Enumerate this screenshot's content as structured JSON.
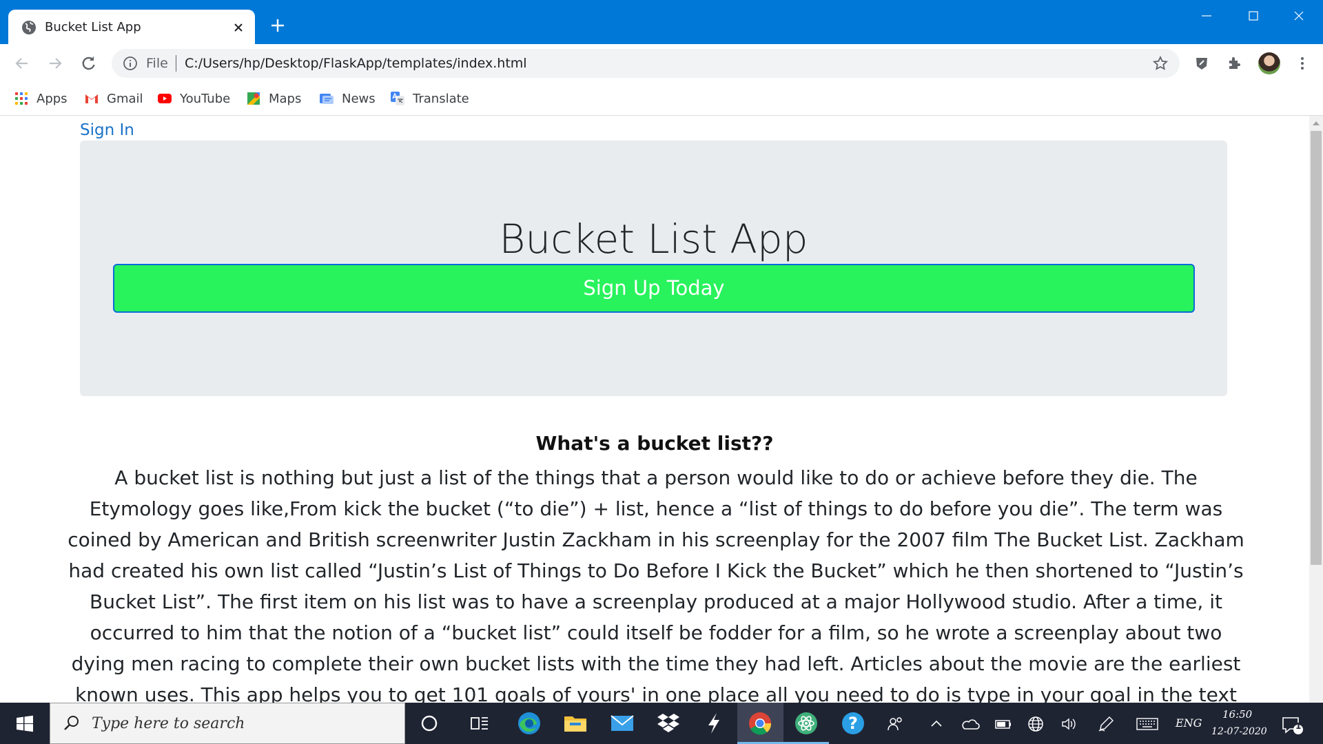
{
  "browser": {
    "tab_title": "Bucket List App",
    "address_scheme": "File",
    "address_url": "C:/Users/hp/Desktop/FlaskApp/templates/index.html"
  },
  "bookmarks": [
    {
      "label": "Apps",
      "icon": "apps-grid-icon"
    },
    {
      "label": "Gmail",
      "icon": "gmail-icon"
    },
    {
      "label": "YouTube",
      "icon": "youtube-icon"
    },
    {
      "label": "Maps",
      "icon": "maps-icon"
    },
    {
      "label": "News",
      "icon": "news-icon"
    },
    {
      "label": "Translate",
      "icon": "translate-icon"
    }
  ],
  "page": {
    "signin_link": "Sign In",
    "jumbotron_title": "Bucket List App",
    "signup_button": "Sign Up Today",
    "about_heading": "What's a bucket list??",
    "about_text": "A bucket list is nothing but just a list of the things that a person would like to do or achieve before they die. The Etymology goes like,From kick the bucket (“to die”) + list, hence a “list of things to do before you die”. The term was coined by American and British screenwriter Justin Zackham in his screenplay for the 2007 film The Bucket List. Zackham had created his own list called “Justin’s List of Things to Do Before I Kick the Bucket” which he then shortened to “Justin’s Bucket List”. The first item on his list was to have a screenplay produced at a major Hollywood studio. After a time, it occurred to him that the notion of a “bucket list” could itself be fodder for a film, so he wrote a screenplay about two dying men racing to complete their own bucket lists with the time they had left. Articles about the movie are the earliest known uses. This app helps you to get 101 goals of yours' in one place all you need to do is type in your goal in the text box provided and it will be added in the home page which is accesible"
  },
  "colors": {
    "titlebar": "#0078d7",
    "signup_button": "#28f25c",
    "signup_border": "#0a6bd8",
    "link": "#1a73c8",
    "jumbotron": "#e9ecef",
    "taskbar": "#1f2433"
  },
  "taskbar": {
    "search_placeholder": "Type here to search",
    "language": "ENG",
    "time": "16:50",
    "date": "12-07-2020",
    "notification_count": "1"
  }
}
